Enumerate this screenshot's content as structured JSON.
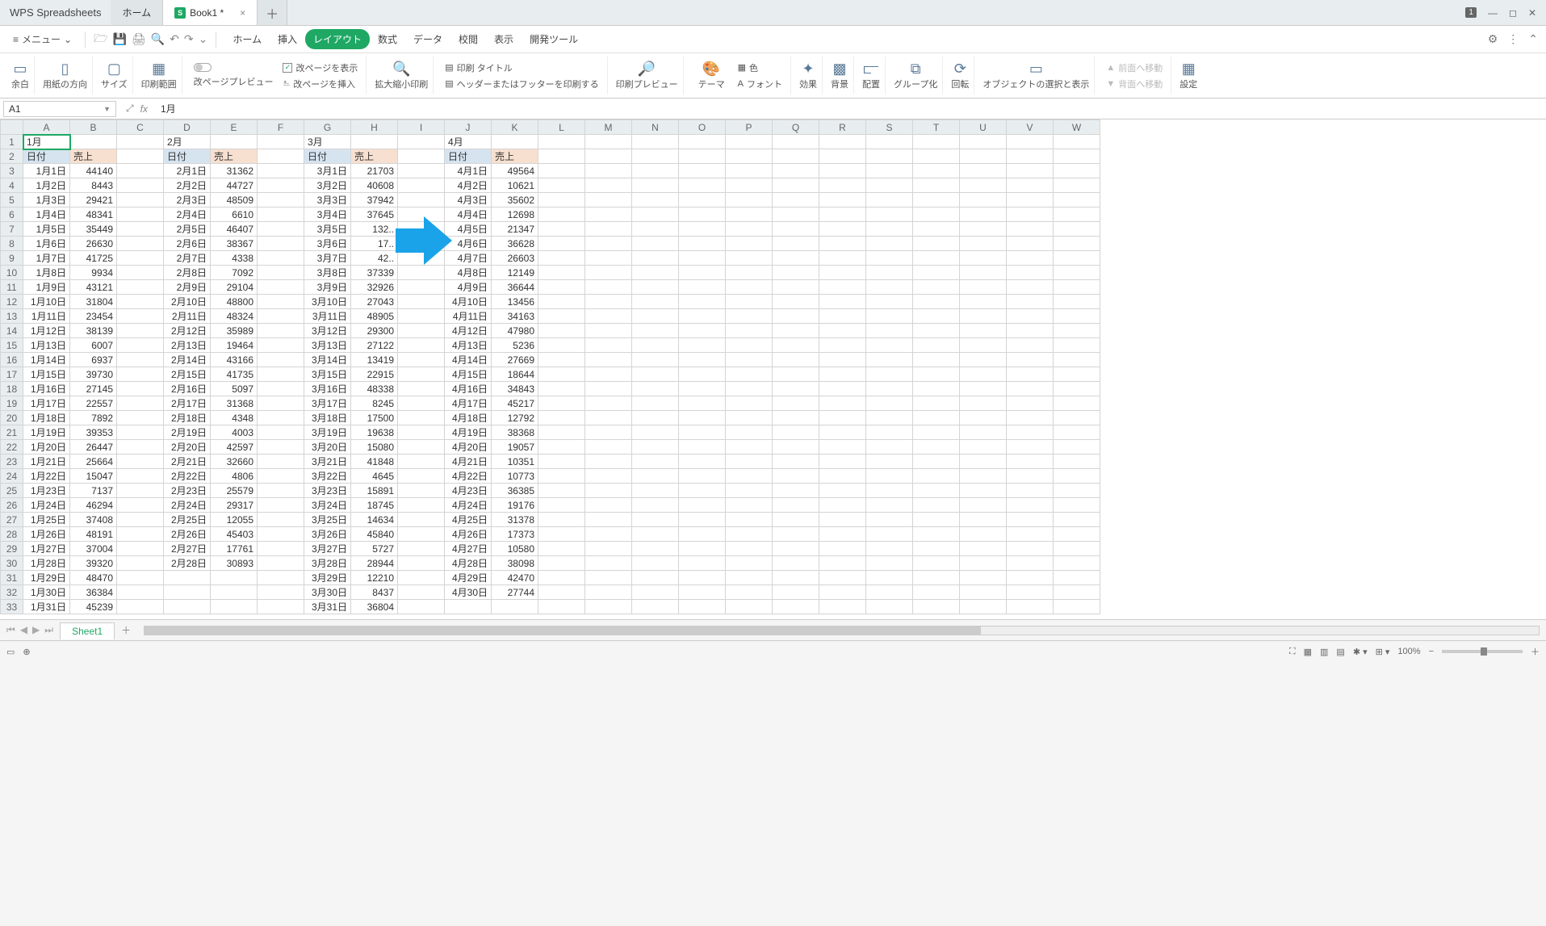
{
  "app_name": "WPS Spreadsheets",
  "doc_tabs": [
    {
      "label": "ホーム",
      "active": false,
      "has_icon": false
    },
    {
      "label": "Book1 *",
      "active": true,
      "has_icon": true
    }
  ],
  "window_badge": "1",
  "menu": {
    "menu_label": "メニュー",
    "tabs": [
      "ホーム",
      "挿入",
      "レイアウト",
      "数式",
      "データ",
      "校閲",
      "表示",
      "開発ツール"
    ],
    "active_tab_index": 2
  },
  "ribbon": {
    "margin": "余白",
    "orientation": "用紙の方向",
    "size": "サイズ",
    "print_area": "印刷範囲",
    "page_break_preview": "改ページプレビュー",
    "show_page_break": "改ページを表示",
    "insert_page_break": "改ページを挿入",
    "zoom_print": "拡大縮小印刷",
    "print_title": "印刷 タイトル",
    "print_header_footer": "ヘッダーまたはフッターを印刷する",
    "print_preview": "印刷プレビュー",
    "theme": "テーマ",
    "color": "色",
    "font": "フォント",
    "effects": "効果",
    "background": "背景",
    "align": "配置",
    "group": "グループ化",
    "rotate": "回転",
    "select_show_object": "オブジェクトの選択と表示",
    "move_front": "前面へ移動",
    "move_back": "背面へ移動",
    "settings": "設定"
  },
  "namebox": "A1",
  "formula_value": "1月",
  "columns": [
    "A",
    "B",
    "C",
    "D",
    "E",
    "F",
    "G",
    "H",
    "I",
    "J",
    "K",
    "L",
    "M",
    "N",
    "O",
    "P",
    "Q",
    "R",
    "S",
    "T",
    "U",
    "V",
    "W"
  ],
  "row_count": 33,
  "months": {
    "A": "1月",
    "D": "2月",
    "G": "3月",
    "J": "4月"
  },
  "header_labels": {
    "date": "日付",
    "sales": "売上"
  },
  "blocks": [
    {
      "date_col": 0,
      "sales_col": 1,
      "rows": [
        [
          "1月1日",
          44140
        ],
        [
          "1月2日",
          8443
        ],
        [
          "1月3日",
          29421
        ],
        [
          "1月4日",
          48341
        ],
        [
          "1月5日",
          35449
        ],
        [
          "1月6日",
          26630
        ],
        [
          "1月7日",
          41725
        ],
        [
          "1月8日",
          9934
        ],
        [
          "1月9日",
          43121
        ],
        [
          "1月10日",
          31804
        ],
        [
          "1月11日",
          23454
        ],
        [
          "1月12日",
          38139
        ],
        [
          "1月13日",
          6007
        ],
        [
          "1月14日",
          6937
        ],
        [
          "1月15日",
          39730
        ],
        [
          "1月16日",
          27145
        ],
        [
          "1月17日",
          22557
        ],
        [
          "1月18日",
          7892
        ],
        [
          "1月19日",
          39353
        ],
        [
          "1月20日",
          26447
        ],
        [
          "1月21日",
          25664
        ],
        [
          "1月22日",
          15047
        ],
        [
          "1月23日",
          7137
        ],
        [
          "1月24日",
          46294
        ],
        [
          "1月25日",
          37408
        ],
        [
          "1月26日",
          48191
        ],
        [
          "1月27日",
          37004
        ],
        [
          "1月28日",
          39320
        ],
        [
          "1月29日",
          48470
        ],
        [
          "1月30日",
          36384
        ],
        [
          "1月31日",
          45239
        ]
      ]
    },
    {
      "date_col": 3,
      "sales_col": 4,
      "rows": [
        [
          "2月1日",
          31362
        ],
        [
          "2月2日",
          44727
        ],
        [
          "2月3日",
          48509
        ],
        [
          "2月4日",
          6610
        ],
        [
          "2月5日",
          46407
        ],
        [
          "2月6日",
          38367
        ],
        [
          "2月7日",
          4338
        ],
        [
          "2月8日",
          7092
        ],
        [
          "2月9日",
          29104
        ],
        [
          "2月10日",
          48800
        ],
        [
          "2月11日",
          48324
        ],
        [
          "2月12日",
          35989
        ],
        [
          "2月13日",
          19464
        ],
        [
          "2月14日",
          43166
        ],
        [
          "2月15日",
          41735
        ],
        [
          "2月16日",
          5097
        ],
        [
          "2月17日",
          31368
        ],
        [
          "2月18日",
          4348
        ],
        [
          "2月19日",
          4003
        ],
        [
          "2月20日",
          42597
        ],
        [
          "2月21日",
          32660
        ],
        [
          "2月22日",
          4806
        ],
        [
          "2月23日",
          25579
        ],
        [
          "2月24日",
          29317
        ],
        [
          "2月25日",
          12055
        ],
        [
          "2月26日",
          45403
        ],
        [
          "2月27日",
          17761
        ],
        [
          "2月28日",
          30893
        ]
      ]
    },
    {
      "date_col": 6,
      "sales_col": 7,
      "rows": [
        [
          "3月1日",
          21703
        ],
        [
          "3月2日",
          40608
        ],
        [
          "3月3日",
          37942
        ],
        [
          "3月4日",
          37645
        ],
        [
          "3月5日",
          "132.."
        ],
        [
          "3月6日",
          "17.."
        ],
        [
          "3月7日",
          "42.."
        ],
        [
          "3月8日",
          37339
        ],
        [
          "3月9日",
          32926
        ],
        [
          "3月10日",
          27043
        ],
        [
          "3月11日",
          48905
        ],
        [
          "3月12日",
          29300
        ],
        [
          "3月13日",
          27122
        ],
        [
          "3月14日",
          13419
        ],
        [
          "3月15日",
          22915
        ],
        [
          "3月16日",
          48338
        ],
        [
          "3月17日",
          8245
        ],
        [
          "3月18日",
          17500
        ],
        [
          "3月19日",
          19638
        ],
        [
          "3月20日",
          15080
        ],
        [
          "3月21日",
          41848
        ],
        [
          "3月22日",
          4645
        ],
        [
          "3月23日",
          15891
        ],
        [
          "3月24日",
          18745
        ],
        [
          "3月25日",
          14634
        ],
        [
          "3月26日",
          45840
        ],
        [
          "3月27日",
          5727
        ],
        [
          "3月28日",
          28944
        ],
        [
          "3月29日",
          12210
        ],
        [
          "3月30日",
          8437
        ],
        [
          "3月31日",
          36804
        ]
      ]
    },
    {
      "date_col": 9,
      "sales_col": 10,
      "rows": [
        [
          "4月1日",
          49564
        ],
        [
          "4月2日",
          10621
        ],
        [
          "4月3日",
          35602
        ],
        [
          "4月4日",
          12698
        ],
        [
          "4月5日",
          21347
        ],
        [
          "4月6日",
          36628
        ],
        [
          "4月7日",
          26603
        ],
        [
          "4月8日",
          12149
        ],
        [
          "4月9日",
          36644
        ],
        [
          "4月10日",
          13456
        ],
        [
          "4月11日",
          34163
        ],
        [
          "4月12日",
          47980
        ],
        [
          "4月13日",
          5236
        ],
        [
          "4月14日",
          27669
        ],
        [
          "4月15日",
          18644
        ],
        [
          "4月16日",
          34843
        ],
        [
          "4月17日",
          45217
        ],
        [
          "4月18日",
          12792
        ],
        [
          "4月19日",
          38368
        ],
        [
          "4月20日",
          19057
        ],
        [
          "4月21日",
          10351
        ],
        [
          "4月22日",
          10773
        ],
        [
          "4月23日",
          36385
        ],
        [
          "4月24日",
          19176
        ],
        [
          "4月25日",
          31378
        ],
        [
          "4月26日",
          17373
        ],
        [
          "4月27日",
          10580
        ],
        [
          "4月28日",
          38098
        ],
        [
          "4月29日",
          42470
        ],
        [
          "4月30日",
          27744
        ]
      ]
    }
  ],
  "sheet_tab": "Sheet1",
  "zoom": "100%"
}
